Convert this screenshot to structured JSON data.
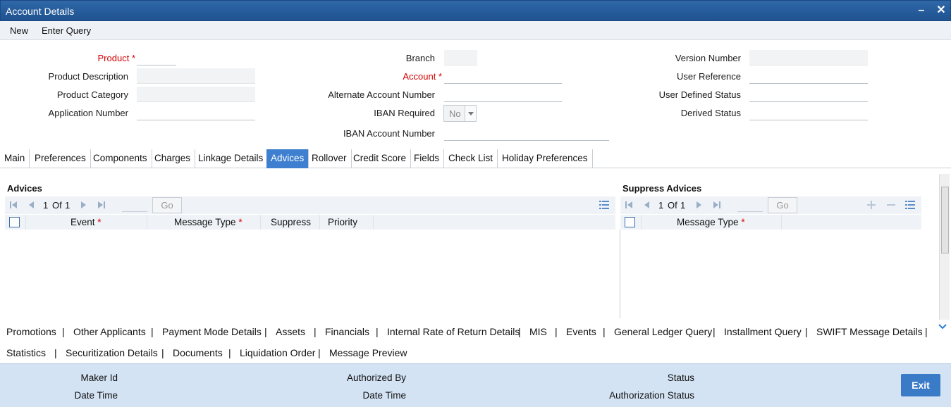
{
  "window": {
    "title": "Account Details",
    "minimize_icon": "minimize-icon",
    "close_icon": "close-icon"
  },
  "menu": {
    "new": "New",
    "enter_query": "Enter Query"
  },
  "form": {
    "product": "Product",
    "product_description": "Product Description",
    "product_category": "Product Category",
    "application_number": "Application Number",
    "branch": "Branch",
    "account": "Account",
    "alternate_account_number": "Alternate Account Number",
    "iban_required": "IBAN Required",
    "iban_required_value": "No",
    "iban_account_number": "IBAN Account Number",
    "version_number": "Version Number",
    "user_reference": "User Reference",
    "user_defined_status": "User Defined Status",
    "derived_status": "Derived Status",
    "required_mark": "*"
  },
  "tabs": [
    "Main",
    "Preferences",
    "Components",
    "Charges",
    "Linkage Details",
    "Advices",
    "Rollover",
    "Credit Score",
    "Fields",
    "Check List",
    "Holiday Preferences"
  ],
  "active_tab": "Advices",
  "advices": {
    "title": "Advices",
    "page_current": "1",
    "page_of": "Of",
    "page_total": "1",
    "go": "Go",
    "columns": {
      "event": "Event",
      "message_type": "Message Type",
      "suppress": "Suppress",
      "priority": "Priority"
    }
  },
  "suppress_advices": {
    "title": "Suppress Advices",
    "page_current": "1",
    "page_of": "Of",
    "page_total": "1",
    "go": "Go",
    "columns": {
      "message_type": "Message Type"
    }
  },
  "links_row1": [
    "Promotions",
    "Other Applicants",
    "Payment Mode Details",
    "Assets",
    "Financials",
    "Internal Rate of Return Details",
    "MIS",
    "Events",
    "General Ledger Query",
    "Installment Query",
    "SWIFT Message Details"
  ],
  "links_row2": [
    "Statistics",
    "Securitization Details",
    "Documents",
    "Liquidation Order",
    "Message Preview"
  ],
  "link_separator": "|",
  "footer": {
    "maker_id": "Maker Id",
    "date_time": "Date Time",
    "authorized_by": "Authorized By",
    "date_time_2": "Date Time",
    "status": "Status",
    "authorization_status": "Authorization Status",
    "exit": "Exit"
  },
  "colors": {
    "titlebar": "#2a62a3",
    "active_tab": "#3e7fcf",
    "footer": "#d4e3f4",
    "required": "#d40000"
  }
}
